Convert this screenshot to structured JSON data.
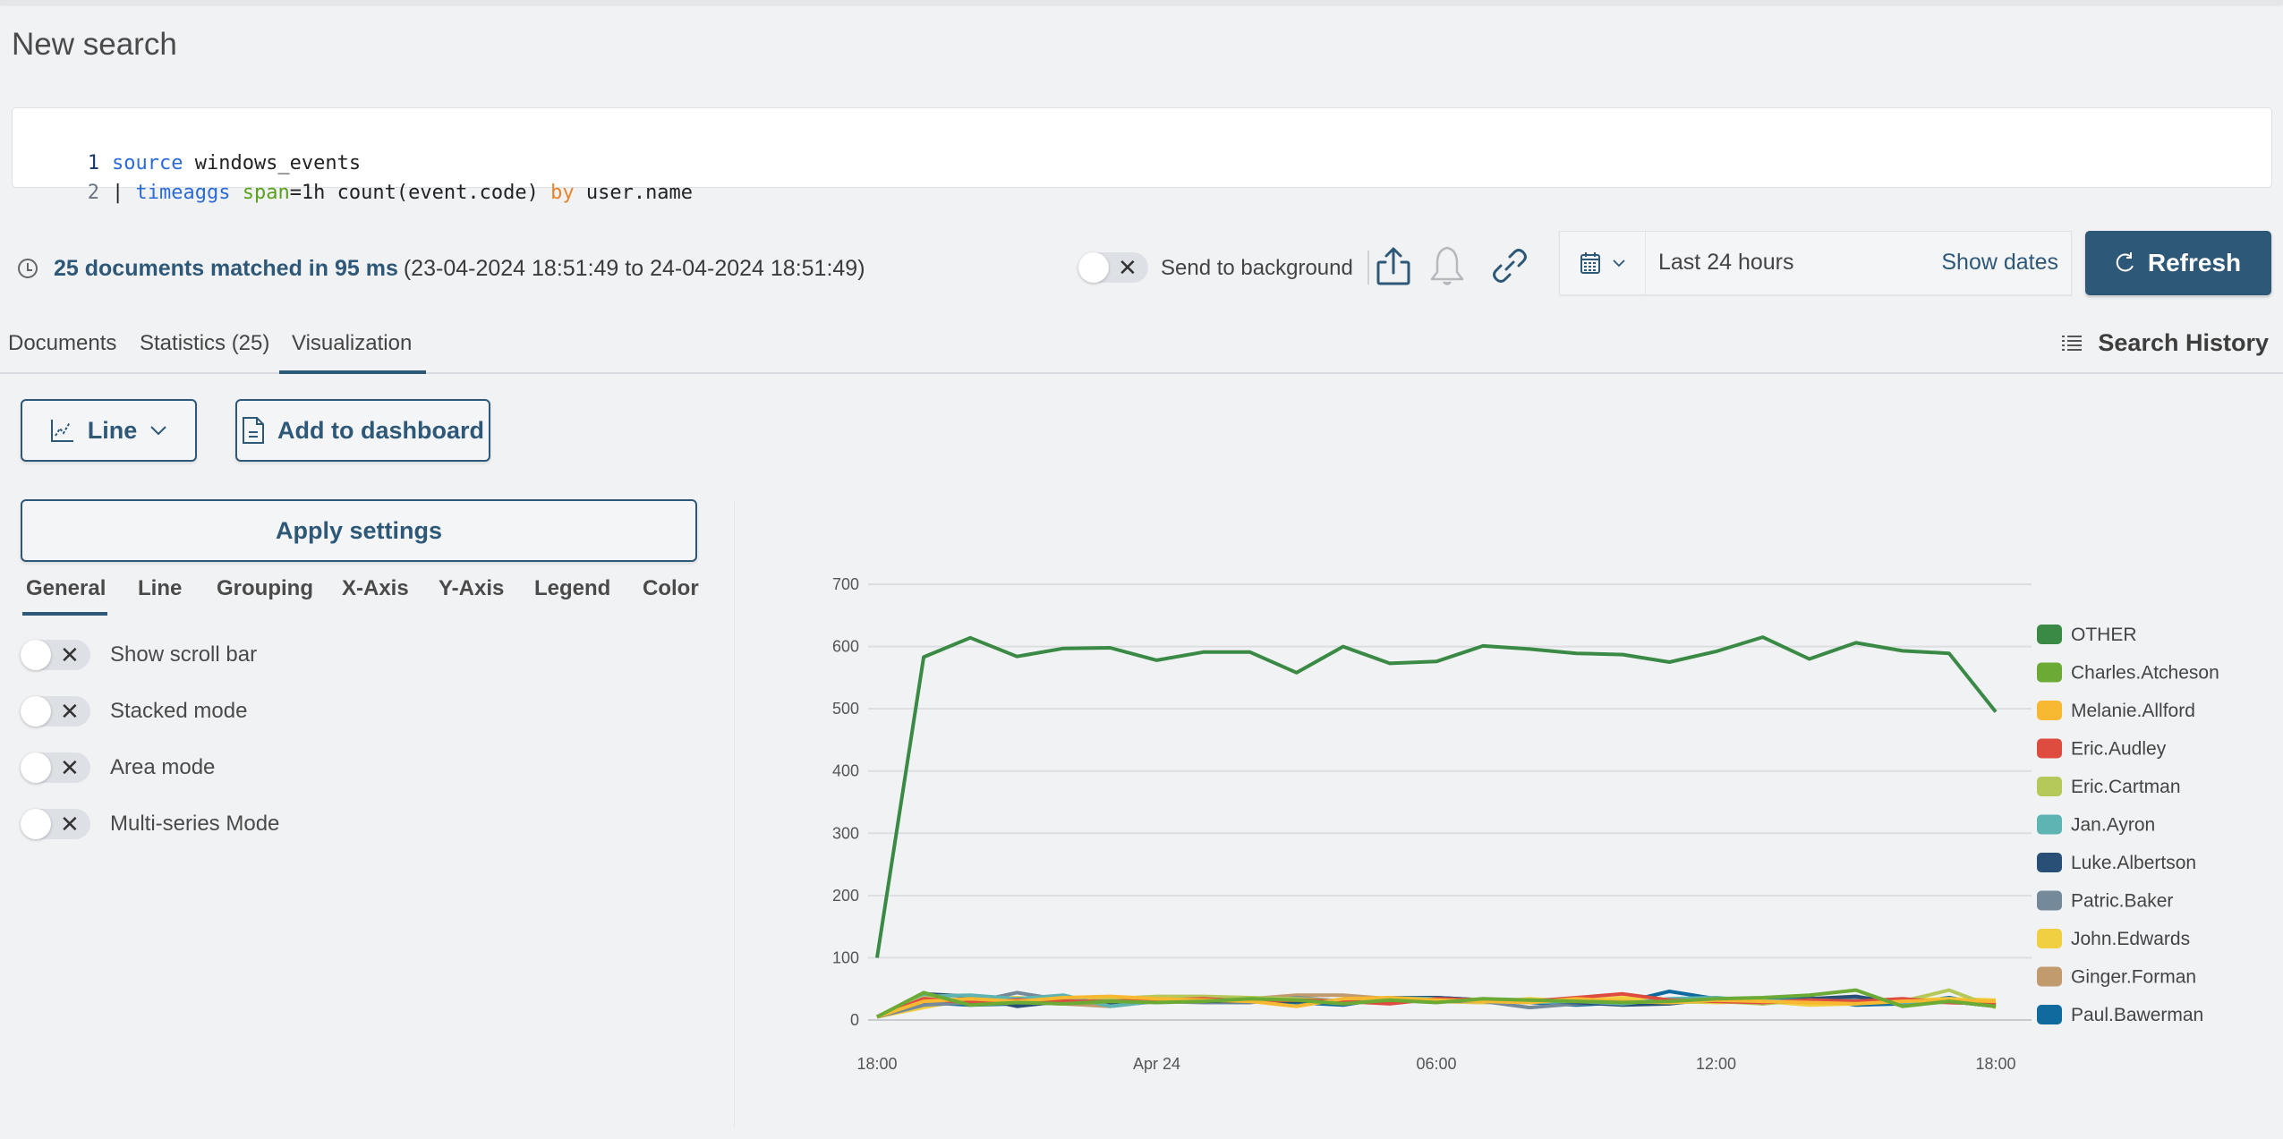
{
  "page": {
    "title": "New search"
  },
  "query": {
    "lines": [
      {
        "num": "1",
        "tokens": [
          {
            "text": "source",
            "kind": "keyword"
          },
          {
            "text": " windows_events",
            "kind": "plain"
          }
        ]
      },
      {
        "num": "2",
        "tokens": [
          {
            "text": "| ",
            "kind": "plain"
          },
          {
            "text": "timeaggs",
            "kind": "keyword"
          },
          {
            "text": " ",
            "kind": "plain"
          },
          {
            "text": "span",
            "kind": "param"
          },
          {
            "text": "=1h count(event.code) ",
            "kind": "plain"
          },
          {
            "text": "by",
            "kind": "operator"
          },
          {
            "text": " user.name",
            "kind": "plain"
          }
        ]
      }
    ]
  },
  "status": {
    "summary": "25 documents matched in 95 ms",
    "range": "(23-04-2024 18:51:49 to 24-04-2024 18:51:49)"
  },
  "toolbar": {
    "send_to_background_label": "Send to background",
    "send_to_background_on": false,
    "icons": [
      "share-icon",
      "bell-icon",
      "link-icon"
    ],
    "time_range": "Last 24 hours",
    "show_dates_label": "Show dates",
    "refresh_label": "Refresh"
  },
  "tabs": {
    "items": [
      "Documents",
      "Statistics (25)",
      "Visualization"
    ],
    "active": "Visualization",
    "search_history_label": "Search History"
  },
  "viz": {
    "chart_type_label": "Line",
    "add_to_dashboard_label": "Add to dashboard",
    "apply_settings_label": "Apply settings",
    "settings_tabs": [
      "General",
      "Line",
      "Grouping",
      "X-Axis",
      "Y-Axis",
      "Legend",
      "Color"
    ],
    "active_settings_tab": "General",
    "options": [
      {
        "label": "Show scroll bar",
        "on": false
      },
      {
        "label": "Stacked mode",
        "on": false
      },
      {
        "label": "Area mode",
        "on": false
      },
      {
        "label": "Multi-series Mode",
        "on": false
      }
    ]
  },
  "colors": {
    "accent": "#2e5878",
    "background": "#f1f2f4"
  },
  "chart_data": {
    "type": "line",
    "title": "",
    "xlabel": "",
    "ylabel": "",
    "x": [
      "Apr 23 18:00",
      "19:00",
      "20:00",
      "21:00",
      "22:00",
      "23:00",
      "Apr 24 00:00",
      "01:00",
      "02:00",
      "03:00",
      "04:00",
      "05:00",
      "06:00",
      "07:00",
      "08:00",
      "09:00",
      "10:00",
      "11:00",
      "12:00",
      "13:00",
      "14:00",
      "15:00",
      "16:00",
      "17:00",
      "18:00"
    ],
    "x_tick_labels": [
      "18:00",
      "Apr 24",
      "06:00",
      "12:00",
      "18:00"
    ],
    "x_tick_indices": [
      0,
      6,
      12,
      18,
      24
    ],
    "ylim": [
      0,
      700
    ],
    "y_ticks": [
      0,
      100,
      200,
      300,
      400,
      500,
      600,
      700
    ],
    "grid": true,
    "legend_position": "right",
    "series": [
      {
        "name": "OTHER",
        "color": "#3a8a45",
        "values": [
          100,
          583,
          614,
          584,
          597,
          598,
          578,
          591,
          591,
          558,
          600,
          573,
          576,
          601,
          596,
          589,
          587,
          575,
          592,
          615,
          580,
          606,
          593,
          589,
          495
        ]
      },
      {
        "name": "Charles.Atcheson",
        "color": "#6aaa35",
        "values": [
          5,
          44,
          24,
          28,
          26,
          30,
          28,
          30,
          34,
          32,
          26,
          32,
          28,
          34,
          32,
          30,
          28,
          30,
          34,
          36,
          40,
          48,
          22,
          30,
          22
        ]
      },
      {
        "name": "Melanie.Allford",
        "color": "#f7b932",
        "values": [
          5,
          30,
          34,
          30,
          36,
          38,
          34,
          32,
          30,
          22,
          34,
          36,
          32,
          30,
          28,
          34,
          30,
          28,
          32,
          30,
          28,
          26,
          30,
          32,
          30
        ]
      },
      {
        "name": "Eric.Audley",
        "color": "#de4c3f",
        "values": [
          5,
          34,
          28,
          32,
          30,
          30,
          32,
          34,
          30,
          32,
          30,
          26,
          34,
          32,
          30,
          36,
          42,
          32,
          30,
          28,
          32,
          30,
          34,
          28,
          26
        ]
      },
      {
        "name": "Eric.Cartman",
        "color": "#b5c95a",
        "values": [
          5,
          36,
          30,
          30,
          26,
          34,
          38,
          38,
          36,
          34,
          30,
          32,
          30,
          34,
          30,
          32,
          30,
          28,
          30,
          26,
          32,
          28,
          30,
          48,
          20
        ]
      },
      {
        "name": "Jan.Ayron",
        "color": "#5eb3b3",
        "values": [
          5,
          38,
          40,
          34,
          40,
          22,
          30,
          32,
          30,
          34,
          30,
          36,
          34,
          30,
          28,
          30,
          26,
          34,
          36,
          30,
          32,
          30,
          28,
          30,
          28
        ]
      },
      {
        "name": "Luke.Albertson",
        "color": "#284f75",
        "values": [
          5,
          42,
          38,
          22,
          30,
          28,
          32,
          30,
          30,
          30,
          28,
          36,
          36,
          32,
          30,
          28,
          24,
          26,
          34,
          26,
          34,
          38,
          26,
          30,
          22
        ]
      },
      {
        "name": "Patric.Baker",
        "color": "#74899a",
        "values": [
          5,
          24,
          28,
          44,
          32,
          28,
          30,
          28,
          28,
          36,
          30,
          34,
          30,
          30,
          20,
          26,
          28,
          30,
          32,
          30,
          30,
          36,
          30,
          30,
          26
        ]
      },
      {
        "name": "John.Edwards",
        "color": "#f0d040",
        "values": [
          5,
          20,
          34,
          36,
          32,
          36,
          34,
          34,
          36,
          30,
          28,
          34,
          30,
          28,
          34,
          30,
          36,
          30,
          28,
          30,
          24,
          26,
          32,
          34,
          32
        ]
      },
      {
        "name": "Ginger.Forman",
        "color": "#c19a6e",
        "values": [
          5,
          30,
          30,
          28,
          26,
          22,
          30,
          30,
          34,
          40,
          40,
          34,
          30,
          28,
          30,
          32,
          30,
          32,
          30,
          28,
          30,
          32,
          30,
          28,
          26
        ]
      },
      {
        "name": "Paul.Bawerman",
        "color": "#0f6a9e",
        "values": [
          5,
          28,
          24,
          26,
          28,
          36,
          32,
          32,
          32,
          28,
          24,
          36,
          36,
          32,
          28,
          24,
          28,
          46,
          34,
          30,
          36,
          24,
          26,
          36,
          24
        ]
      }
    ]
  }
}
